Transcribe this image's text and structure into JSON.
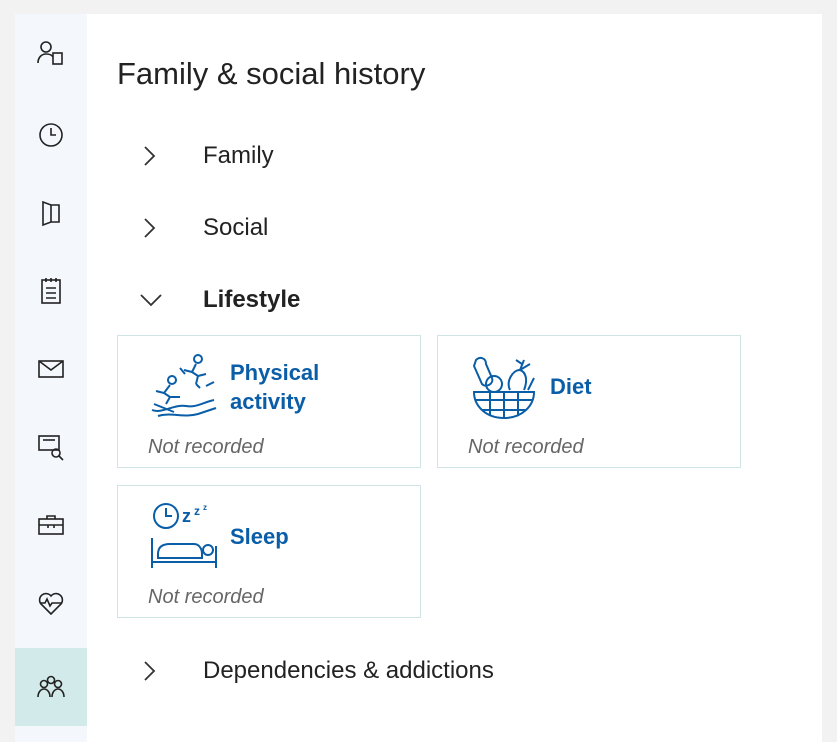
{
  "page": {
    "title": "Family & social history"
  },
  "sidebar": {
    "items": [
      {
        "icon": "person-document-icon",
        "active": false
      },
      {
        "icon": "clock-icon",
        "active": false
      },
      {
        "icon": "open-book-icon",
        "active": false
      },
      {
        "icon": "notepad-icon",
        "active": false
      },
      {
        "icon": "envelope-icon",
        "active": false
      },
      {
        "icon": "screen-search-icon",
        "active": false
      },
      {
        "icon": "briefcase-icon",
        "active": false
      },
      {
        "icon": "heart-pulse-icon",
        "active": false
      },
      {
        "icon": "people-group-icon",
        "active": true
      }
    ]
  },
  "sections": {
    "family": {
      "label": "Family",
      "expanded": false
    },
    "social": {
      "label": "Social",
      "expanded": false
    },
    "lifestyle": {
      "label": "Lifestyle",
      "expanded": true
    },
    "dependencies": {
      "label": "Dependencies & addictions",
      "expanded": false
    }
  },
  "lifestyle_cards": {
    "physical_activity": {
      "title_line1": "Physical",
      "title_line2": "activity",
      "status": "Not recorded",
      "icon": "physical-activity-icon"
    },
    "diet": {
      "title": "Diet",
      "status": "Not recorded",
      "icon": "diet-basket-icon"
    },
    "sleep": {
      "title": "Sleep",
      "status": "Not recorded",
      "icon": "sleep-bed-icon"
    }
  },
  "colors": {
    "accent": "#0a5ea8",
    "sidebar_bg": "#f4f8fc",
    "active_bg": "#d3eaea",
    "card_border": "#cfe4e4"
  }
}
